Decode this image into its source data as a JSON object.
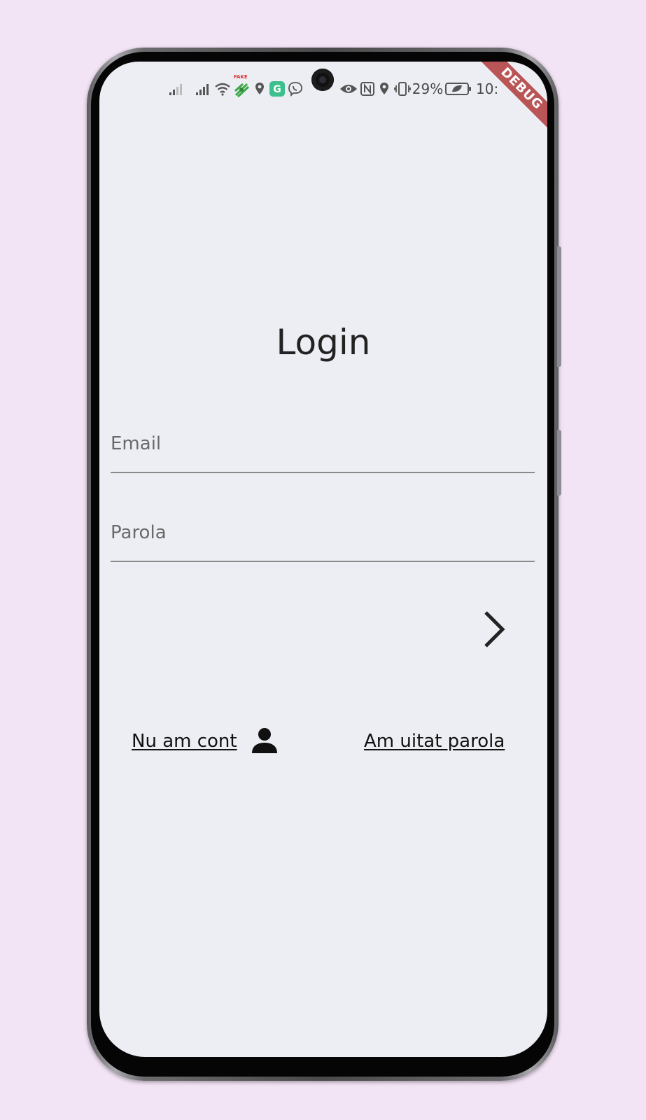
{
  "status_bar": {
    "battery_percent": "29%",
    "time": "10:",
    "icons": [
      "signal-weak-icon",
      "signal-icon",
      "wifi-icon",
      "fake-gps-icon",
      "location-icon",
      "grammarly-icon",
      "viber-icon",
      "eye-icon",
      "nfc-icon",
      "location-icon",
      "vibrate-icon",
      "battery-saver-icon"
    ],
    "fake_label": "FAKE"
  },
  "debug_banner": "DEBUG",
  "login": {
    "title": "Login",
    "email_placeholder": "Email",
    "password_placeholder": "Parola",
    "next_icon": "chevron-right-icon",
    "no_account_label": "Nu am cont",
    "account_icon": "person-icon",
    "forgot_password_label": "Am uitat parola"
  },
  "colors": {
    "background": "#f2e3f5",
    "screen": "#edeef3",
    "text": "#222222",
    "debug_ribbon": "#b03a3a"
  }
}
